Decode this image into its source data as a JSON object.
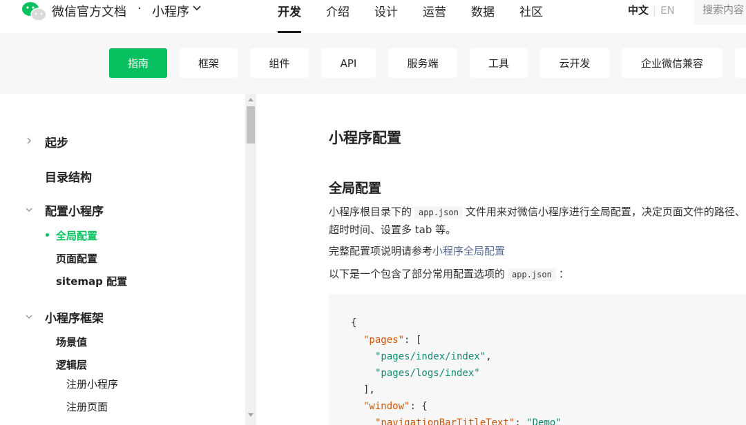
{
  "header": {
    "brand": "微信官方文档",
    "separator": "·",
    "product": "小程序",
    "nav": [
      "开发",
      "介绍",
      "设计",
      "运营",
      "数据",
      "社区"
    ],
    "active_nav": "开发",
    "lang_zh": "中文",
    "lang_en": "EN",
    "search_placeholder": "搜索内容"
  },
  "subnav": {
    "tabs": [
      "指南",
      "框架",
      "组件",
      "API",
      "服务端",
      "工具",
      "云开发",
      "企业微信兼容"
    ],
    "active": "指南"
  },
  "sidebar": {
    "items": [
      {
        "label": "起步",
        "level": 1,
        "chevron": "right"
      },
      {
        "label": "目录结构",
        "level": 1
      },
      {
        "label": "配置小程序",
        "level": 1,
        "chevron": "down"
      },
      {
        "label": "全局配置",
        "level": 2,
        "active": true
      },
      {
        "label": "页面配置",
        "level": 2
      },
      {
        "label": "sitemap 配置",
        "level": 2
      },
      {
        "label": "小程序框架",
        "level": 1,
        "chevron": "down"
      },
      {
        "label": "场景值",
        "level": 2
      },
      {
        "label": "逻辑层",
        "level": 2
      },
      {
        "label": "注册小程序",
        "level": 3
      },
      {
        "label": "注册页面",
        "level": 3
      }
    ]
  },
  "content": {
    "title": "小程序配置",
    "section": "全局配置",
    "p1_before": "小程序根目录下的",
    "p1_code": "app.json",
    "p1_after": "文件用来对微信小程序进行全局配置，决定页面文件的路径、",
    "p1_line2": "超时时间、设置多 tab 等。",
    "p2_before": "完整配置项说明请参考",
    "p2_link": "小程序全局配置",
    "p3_before": "以下是一个包含了部分常用配置选项的",
    "p3_code": "app.json",
    "p3_after": "：",
    "code": {
      "l1": "{",
      "k_pages": "\"pages\"",
      "colon_bracket": ": [",
      "s_index": "\"pages/index/index\"",
      "comma": ",",
      "s_logs": "\"pages/logs/index\"",
      "close_bracket": "],",
      "k_window": "\"window\"",
      "colon_brace": ": {",
      "k_partial": "\"navigationBarTitleText\"",
      "partial_colon": ": ",
      "s_partial": "\"Demo\""
    }
  },
  "colors": {
    "accent": "#07c160",
    "link": "#576b95",
    "code_key": "#d35400",
    "code_string": "#0f8a71"
  },
  "icons": {
    "logo": "wechat-logo-icon",
    "product_dropdown": "chevron-down-icon",
    "tree_collapsed": "chevron-right-icon",
    "tree_expanded": "chevron-down-icon"
  }
}
